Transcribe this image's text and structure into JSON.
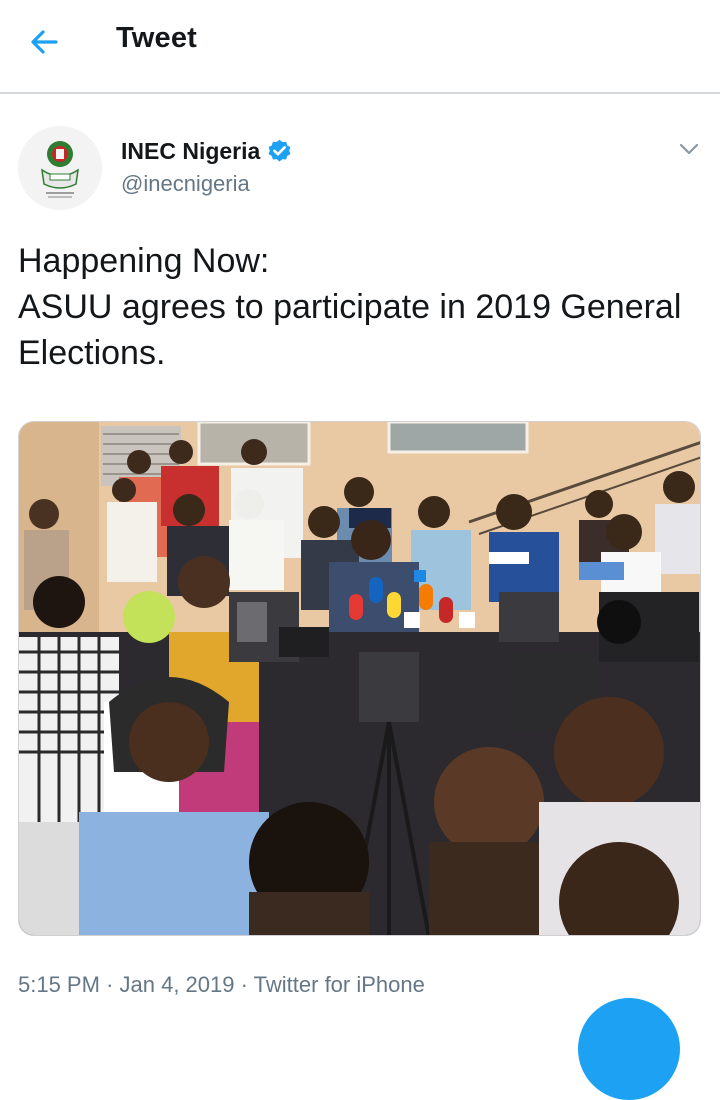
{
  "header": {
    "title": "Tweet",
    "back_icon": "arrow-left-icon"
  },
  "author": {
    "name": "INEC Nigeria",
    "handle": "@inecnigeria",
    "verified": true,
    "avatar_icon": "inec-logo-avatar"
  },
  "tweet": {
    "lines": [
      "Happening Now:",
      "ASUU agrees to participate in 2019 General",
      "Elections."
    ]
  },
  "media": {
    "type": "photo"
  },
  "meta": {
    "time": "5:15 PM",
    "separator": "·",
    "date": "Jan 4, 2019",
    "source": "Twitter for iPhone"
  },
  "colors": {
    "accent": "#1da1f2",
    "text": "#14171a",
    "secondary": "#657786",
    "divider": "#d4d8db"
  }
}
